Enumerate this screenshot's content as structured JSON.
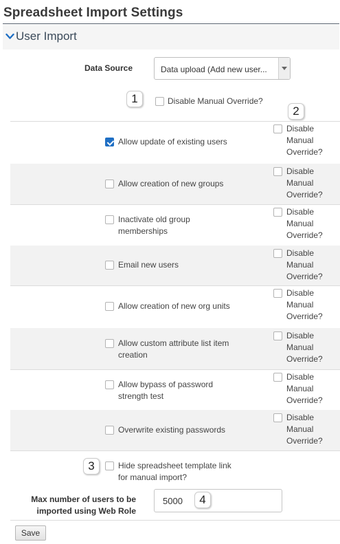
{
  "page": {
    "title": "Spreadsheet Import Settings"
  },
  "section": {
    "title": "User Import"
  },
  "data_source": {
    "label": "Data Source",
    "selected": "Data upload (Add new user..."
  },
  "global_override": {
    "label": "Disable Manual Override?",
    "checked": false
  },
  "dmo_text": [
    "Disable",
    "Manual",
    "Override?"
  ],
  "options": [
    {
      "label_lines": [
        "Allow update of existing users"
      ],
      "checked": true,
      "dmo_checked": false
    },
    {
      "label_lines": [
        "Allow creation of new groups"
      ],
      "checked": false,
      "dmo_checked": false
    },
    {
      "label_lines": [
        "Inactivate old group",
        "memberships"
      ],
      "checked": false,
      "dmo_checked": false
    },
    {
      "label_lines": [
        "Email new users"
      ],
      "checked": false,
      "dmo_checked": false
    },
    {
      "label_lines": [
        "Allow creation of new org units"
      ],
      "checked": false,
      "dmo_checked": false
    },
    {
      "label_lines": [
        "Allow custom attribute list item",
        "creation"
      ],
      "checked": false,
      "dmo_checked": false
    },
    {
      "label_lines": [
        "Allow bypass of password",
        "strength test"
      ],
      "checked": false,
      "dmo_checked": false
    },
    {
      "label_lines": [
        "Overwrite existing passwords"
      ],
      "checked": false,
      "dmo_checked": false
    }
  ],
  "hide_template": {
    "label_lines": [
      "Hide spreadsheet template link",
      "for manual import?"
    ],
    "checked": false
  },
  "max_users": {
    "label_lines": [
      "Max number of users to be",
      "imported using Web Role"
    ],
    "value": "5000"
  },
  "save": {
    "label": "Save"
  },
  "callouts": [
    "1",
    "2",
    "3",
    "4"
  ],
  "colors": {
    "accent": "#1f6fc4",
    "section_bg": "#f5f5f5",
    "alt_row": "#f2f2f2"
  }
}
